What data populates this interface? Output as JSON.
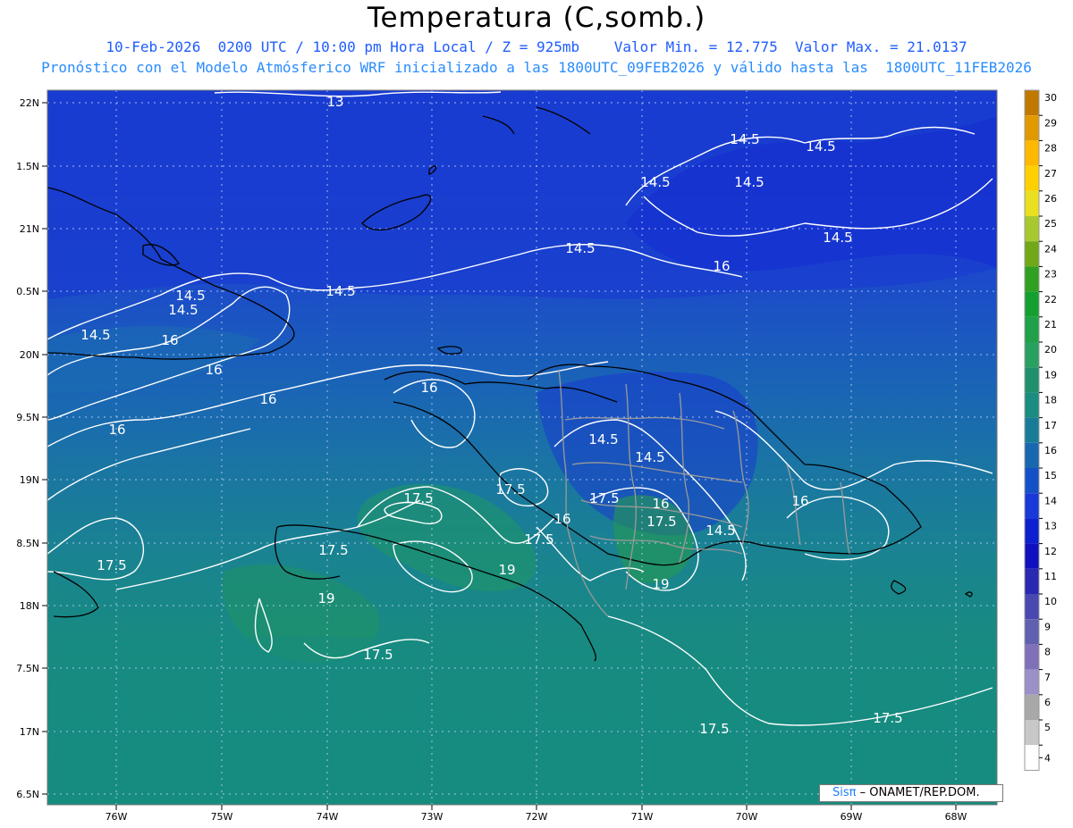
{
  "header": {
    "title": "Temperatura (C,somb.)",
    "line1": "10-Feb-2026  0200 UTC / 10:00 pm Hora Local / Z = 925mb    Valor Min. = 12.775  Valor Max. = 21.0137",
    "line2": "Pronóstico con el Modelo Atmósferico WRF inicializado a las 1800UTC_09FEB2026 y válido hasta las  1800UTC_11FEB2026"
  },
  "axes": {
    "lat_ticks": [
      "22N",
      "1.5N",
      "21N",
      "0.5N",
      "20N",
      "9.5N",
      "19N",
      "8.5N",
      "18N",
      "7.5N",
      "17N",
      "6.5N"
    ],
    "lon_ticks": [
      "76W",
      "75W",
      "74W",
      "73W",
      "72W",
      "71W",
      "70W",
      "69W",
      "68W"
    ]
  },
  "colorbar": {
    "labels": [
      "30",
      "29",
      "28",
      "27",
      "26",
      "25",
      "24",
      "23",
      "22",
      "21",
      "20",
      "19",
      "18",
      "17",
      "16",
      "15",
      "14",
      "13",
      "12",
      "11",
      "10",
      "9",
      "8",
      "7",
      "6",
      "5",
      "4"
    ],
    "colors": [
      "#c07800",
      "#e09a00",
      "#ffb800",
      "#ffd000",
      "#e8e020",
      "#a8c830",
      "#70a818",
      "#30a020",
      "#14a030",
      "#20a048",
      "#28a060",
      "#20906c",
      "#1a8c80",
      "#187c98",
      "#1868b0",
      "#1450c8",
      "#1838d8",
      "#0c20d0",
      "#1010c0",
      "#2828b0",
      "#4848b0",
      "#6060b0",
      "#8070b8",
      "#9c90c8",
      "#a8a8a8",
      "#c8c8c8",
      "#ffffff"
    ]
  },
  "contour_labels": [
    "13",
    "14.5",
    "14.5",
    "14.5",
    "14.5",
    "14.5",
    "14.5",
    "14.5",
    "14.5",
    "14.5",
    "14.5",
    "16",
    "16",
    "16",
    "16",
    "16",
    "16",
    "16",
    "16",
    "16",
    "14.5",
    "14.5",
    "17.5",
    "17.5",
    "17.5",
    "17.5",
    "17.5",
    "17.5",
    "17.5",
    "17.5",
    "17.5",
    "17.5",
    "19",
    "19",
    "19",
    "14.5"
  ],
  "credit": {
    "brand": "Sisπ",
    "text": " – ONAMET/REP.DOM."
  }
}
